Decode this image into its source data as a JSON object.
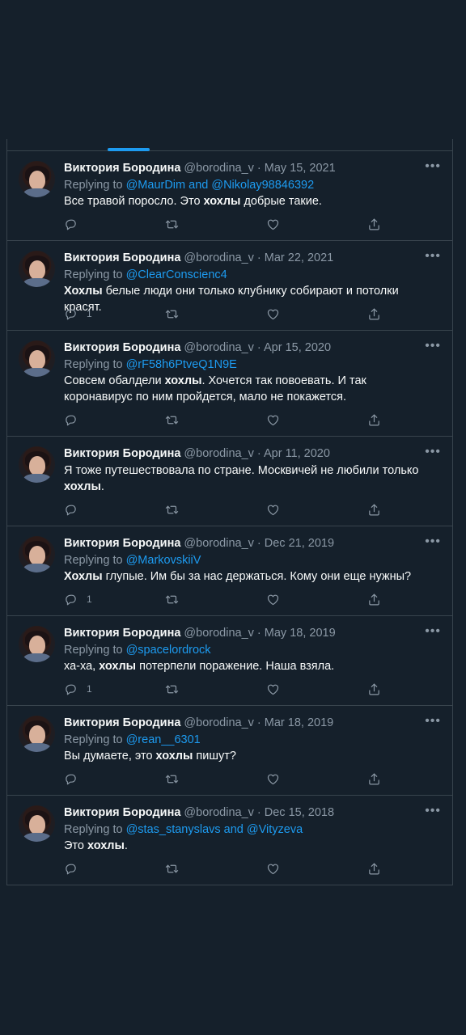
{
  "tweets": [
    {
      "name": "Виктория Бородина",
      "meta": "@borodina_v · May 15, 2021",
      "replying_prefix": "Replying to",
      "replying_to": "@MaurDim and @Nikolay98846392",
      "text_parts": [
        "Все травой поросло. Это ",
        "хохлы",
        " добрые такие."
      ],
      "reply_count": ""
    },
    {
      "name": "Виктория Бородина",
      "meta": "@borodina_v · Mar 22, 2021",
      "replying_prefix": "Replying to",
      "replying_to": "@ClearConscienc4",
      "text_parts": [
        "",
        "Хохлы",
        " белые люди они только клубнику собирают и потолки красят."
      ],
      "reply_count": "1"
    },
    {
      "name": "Виктория Бородина",
      "meta": "@borodina_v · Apr 15, 2020",
      "replying_prefix": "Replying to",
      "replying_to": "@rF58h6PtveQ1N9E",
      "text_parts": [
        "Совсем обалдели ",
        "хохлы",
        ". Хочется так повоевать. И так коронавирус по ним пройдется, мало не покажется."
      ],
      "reply_count": ""
    },
    {
      "name": "Виктория Бородина",
      "meta": "@borodina_v · Apr 11, 2020",
      "replying_prefix": "",
      "replying_to": "",
      "text_parts": [
        "Я тоже путешествовала по стране. Москвичей не любили только ",
        "хохлы",
        "."
      ],
      "reply_count": ""
    },
    {
      "name": "Виктория Бородина",
      "meta": "@borodina_v · Dec 21, 2019",
      "replying_prefix": "Replying to",
      "replying_to": "@MarkovskiiV",
      "text_parts": [
        "",
        "Хохлы",
        " глупые. Им бы за нас держаться. Кому они еще нужны?"
      ],
      "reply_count": "1"
    },
    {
      "name": "Виктория Бородина",
      "meta": "@borodina_v · May 18, 2019",
      "replying_prefix": "Replying to",
      "replying_to": "@spacelordrock",
      "text_parts": [
        "ха-ха, ",
        "хохлы",
        " потерпели поражение. Наша взяла."
      ],
      "reply_count": "1"
    },
    {
      "name": "Виктория Бородина",
      "meta": "@borodina_v · Mar 18, 2019",
      "replying_prefix": "Replying to",
      "replying_to": "@rean__6301",
      "text_parts": [
        "Вы думаете, это ",
        "хохлы",
        " пишут?"
      ],
      "reply_count": ""
    },
    {
      "name": "Виктория Бородина",
      "meta": "@borodina_v · Dec 15, 2018",
      "replying_prefix": "Replying to",
      "replying_to": "@stas_stanyslavs and @Vityzeva",
      "text_parts": [
        "Это ",
        "хохлы",
        "."
      ],
      "reply_count": ""
    }
  ],
  "more_label": "•••",
  "avatar_tag": "..Ш\nс.в.",
  "colors": {
    "background": "#15202b",
    "accent": "#1d9bf0",
    "muted": "#8b98a5",
    "border": "#38444d"
  },
  "icons": [
    "reply-icon",
    "retweet-icon",
    "like-icon",
    "share-icon",
    "more-icon"
  ]
}
